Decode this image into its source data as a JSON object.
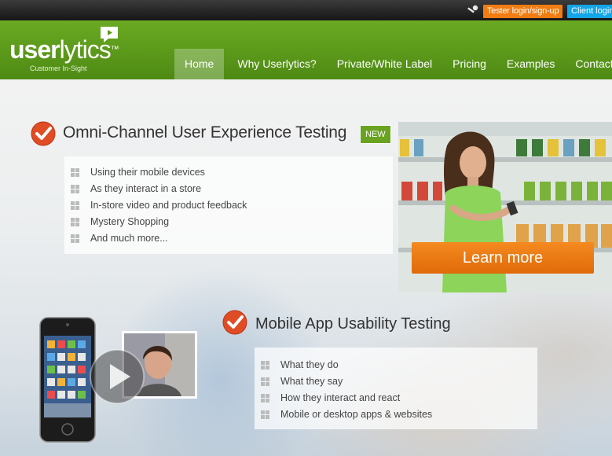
{
  "topbar": {
    "tester_label": "Tester login/sign-up",
    "client_label": "Client login"
  },
  "header": {
    "logo_bold": "user",
    "logo_rest": "lytics",
    "logo_tm": "™",
    "tagline": "Customer In-Sight",
    "nav": [
      {
        "label": "Home",
        "active": true
      },
      {
        "label": "Why Userlytics?"
      },
      {
        "label": "Private/White Label"
      },
      {
        "label": "Pricing"
      },
      {
        "label": "Examples"
      },
      {
        "label": "Contact us"
      }
    ]
  },
  "hero": {
    "section1": {
      "title": "Omni-Channel User Experience Testing",
      "badge": "NEW",
      "items": [
        "Using their mobile devices",
        "As they interact in a store",
        "In-store video and product feedback",
        "Mystery Shopping",
        "And much more..."
      ],
      "cta_label": "Learn more"
    },
    "section2": {
      "title": "Mobile App Usability Testing",
      "items": [
        "What they do",
        "What they say",
        "How they interact and react",
        "Mobile or desktop apps & websites"
      ]
    }
  },
  "colors": {
    "brand_green": "#5c9a1b",
    "accent_orange": "#f07c12",
    "client_blue": "#14a4e8",
    "check_red": "#e04c24"
  },
  "icons": [
    "key-icon",
    "chat-bubble-icon",
    "check-icon",
    "bullet-grid-icon",
    "play-icon"
  ]
}
